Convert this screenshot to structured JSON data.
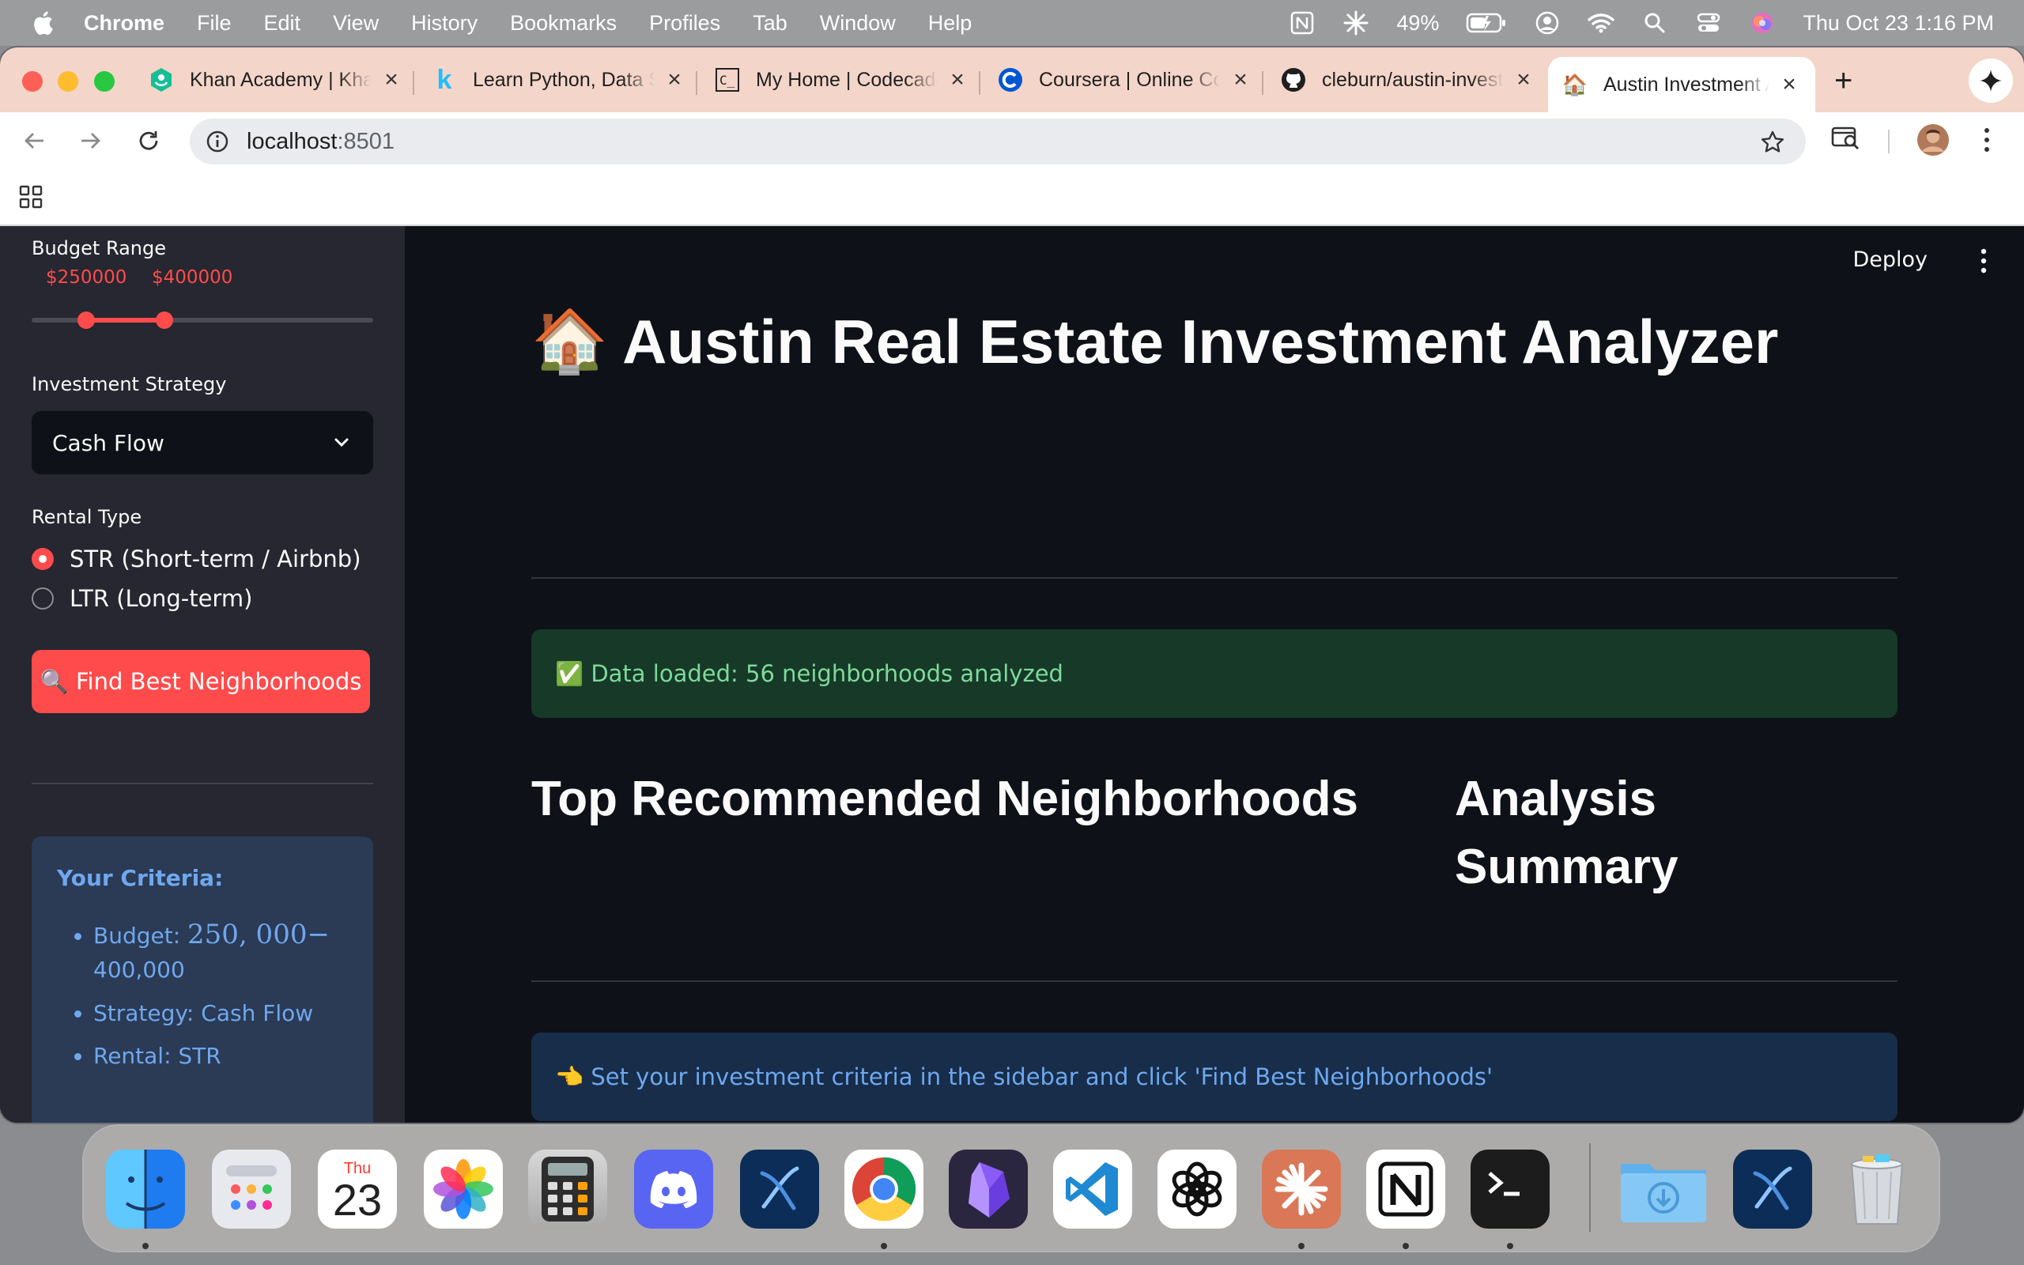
{
  "menubar": {
    "app": "Chrome",
    "items": [
      "File",
      "Edit",
      "View",
      "History",
      "Bookmarks",
      "Profiles",
      "Tab",
      "Window",
      "Help"
    ],
    "battery": "49%",
    "datetime": "Thu Oct 23  1:16 PM"
  },
  "tabs": [
    {
      "title": "Khan Academy | Khan Academy",
      "icon": "khan-academy-icon"
    },
    {
      "title": "Learn Python, Data Science",
      "icon": "kaggle-k-icon"
    },
    {
      "title": "My Home | Codecademy",
      "icon": "codecademy-icon"
    },
    {
      "title": "Coursera | Online Courses",
      "icon": "coursera-icon"
    },
    {
      "title": "cleburn/austin-investment",
      "icon": "github-icon"
    },
    {
      "title": "Austin Investment Analyzer",
      "icon": "house-icon",
      "active": true
    }
  ],
  "address": {
    "host": "localhost",
    "port": ":8501"
  },
  "sidebar": {
    "budget_label": "Budget Range",
    "budget_min": "$250000",
    "budget_max": "$400000",
    "budget_low_fraction": 0.16,
    "budget_high_fraction": 0.39,
    "strategy_label": "Investment Strategy",
    "strategy_value": "Cash Flow",
    "rental_label": "Rental Type",
    "rental_options": [
      "STR (Short-term / Airbnb)",
      "LTR (Long-term)"
    ],
    "rental_selected": 0,
    "find_button": "🔍 Find Best Neighborhoods",
    "criteria": {
      "title": "Your Criteria:",
      "budget_prefix": "Budget: ",
      "budget_math": "250, 000−",
      "budget_rest": "400,000",
      "strategy": "Strategy: Cash Flow",
      "rental": "Rental: STR"
    }
  },
  "main": {
    "deploy": "Deploy",
    "title_emoji": "🏠",
    "title": "Austin Real Estate Investment Analyzer",
    "success_msg": "✅ Data loaded: 56 neighborhoods analyzed",
    "section_left": "Top Recommended Neighborhoods",
    "section_right_line1": "Analysis",
    "section_right_line2": "Summary",
    "info_msg": "👈 Set your investment criteria in the sidebar and click 'Find Best Neighborhoods'"
  },
  "dock": {
    "calendar_month": "Thu",
    "calendar_day": "23",
    "apps": [
      "finder",
      "launchpad",
      "calendar",
      "photos",
      "calculator",
      "discord",
      "perplexity",
      "chrome",
      "obsidian",
      "vscode",
      "chatgpt",
      "claude",
      "notion",
      "terminal",
      "downloads",
      "perplexity-2",
      "trash"
    ]
  },
  "colors": {
    "accent": "#ff4b4b",
    "background": "#0e1117",
    "sidebar": "#262730"
  }
}
